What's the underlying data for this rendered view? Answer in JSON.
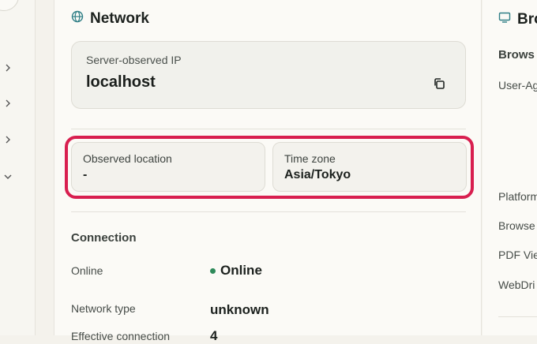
{
  "network": {
    "title": "Network",
    "icon": "globe-icon",
    "server_ip": {
      "label": "Server-observed IP",
      "value": "localhost"
    },
    "location": {
      "label": "Observed location",
      "value": "-"
    },
    "timezone": {
      "label": "Time zone",
      "value": "Asia/Tokyo"
    },
    "connection": {
      "title": "Connection",
      "online": {
        "label": "Online",
        "value": "Online",
        "status_color": "#2e8a5a"
      },
      "network_type": {
        "label": "Network type",
        "value": "unknown"
      },
      "effective_partial": {
        "label": "Effective connection",
        "value": "4"
      }
    }
  },
  "browser": {
    "title": "Bro",
    "icon": "monitor-icon",
    "section": "Brows",
    "rows": [
      "User-Ag",
      "Platform",
      "Browse",
      "PDF Vie",
      "WebDri"
    ]
  },
  "colors": {
    "highlight": "#d81f4f",
    "accent": "#2f7f86"
  }
}
